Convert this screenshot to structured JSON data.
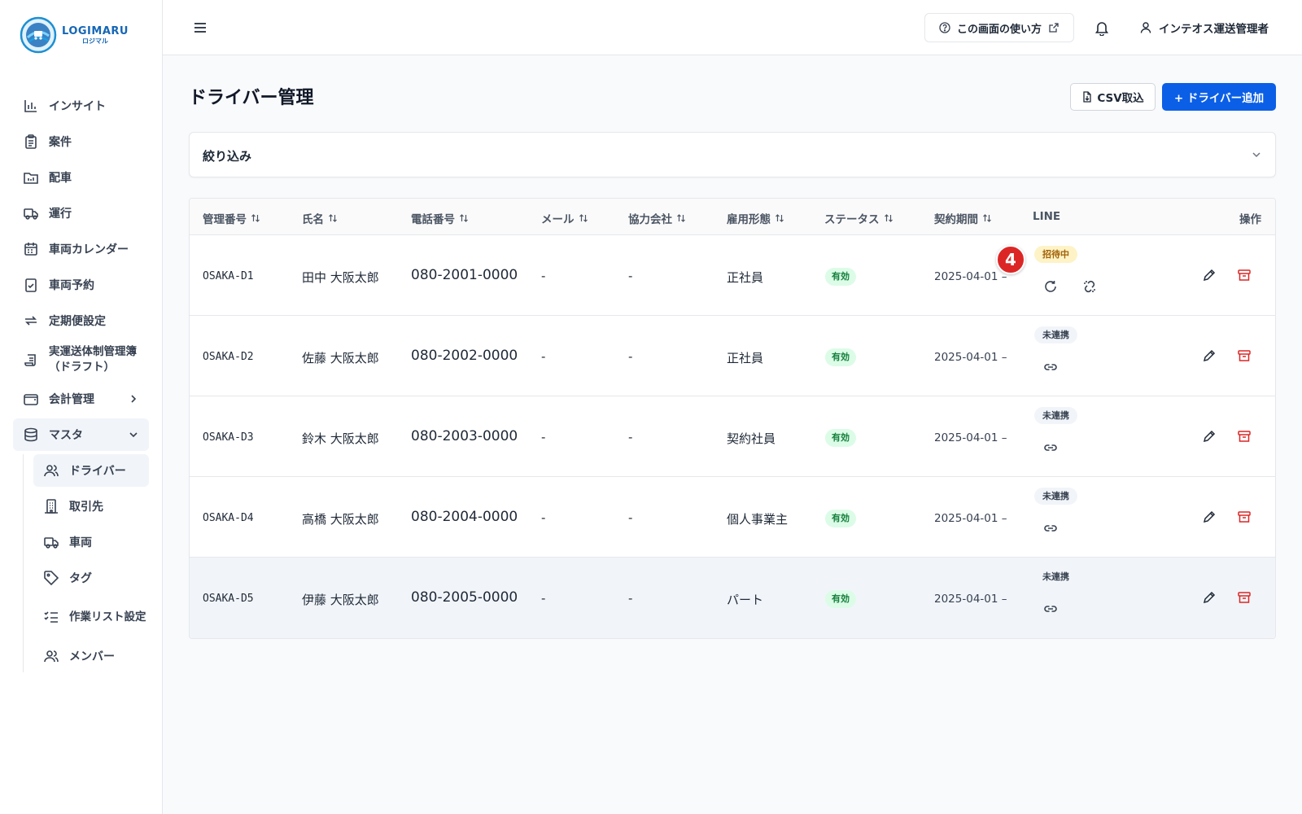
{
  "logo": {
    "en": "LOGIMARU",
    "ja": "ロジマル"
  },
  "sidebar": {
    "items": [
      {
        "label": "インサイト",
        "icon": "bar-chart-icon"
      },
      {
        "label": "案件",
        "icon": "clipboard-icon"
      },
      {
        "label": "配車",
        "icon": "folder-chart-icon"
      },
      {
        "label": "運行",
        "icon": "truck-icon"
      },
      {
        "label": "車両カレンダー",
        "icon": "calendar-icon"
      },
      {
        "label": "車両予約",
        "icon": "calendar-check-icon"
      },
      {
        "label": "定期便設定",
        "icon": "repeat-icon"
      },
      {
        "label": "実運送体制管理簿（ドラフト）",
        "icon": "scroll-icon"
      },
      {
        "label": "会計管理",
        "icon": "wallet-icon"
      },
      {
        "label": "マスタ",
        "icon": "database-icon"
      }
    ],
    "sub_items": [
      {
        "label": "ドライバー",
        "icon": "users-icon"
      },
      {
        "label": "取引先",
        "icon": "building-icon"
      },
      {
        "label": "車両",
        "icon": "truck-icon"
      },
      {
        "label": "タグ",
        "icon": "tag-icon"
      },
      {
        "label": "作業リスト設定",
        "icon": "list-checks-icon"
      },
      {
        "label": "メンバー",
        "icon": "users-icon"
      }
    ]
  },
  "header": {
    "help_label": "この画面の使い方",
    "user_name": "インテオス運送管理者"
  },
  "page": {
    "title": "ドライバー管理",
    "csv_label": "CSV取込",
    "add_label": "+ ドライバー追加"
  },
  "filter": {
    "label": "絞り込み"
  },
  "table": {
    "headers": {
      "id": "管理番号",
      "name": "氏名",
      "phone": "電話番号",
      "mail": "メール",
      "partner": "協力会社",
      "employment": "雇用形態",
      "status": "ステータス",
      "contract": "契約期間",
      "line": "LINE",
      "actions": "操作"
    },
    "rows": [
      {
        "id": "OSAKA-D1",
        "name": "田中 大阪太郎",
        "phone": "080-2001-0000",
        "mail": "-",
        "partner": "-",
        "employment": "正社員",
        "status": "有効",
        "contract": "2025-04-01 –",
        "line": "招待中"
      },
      {
        "id": "OSAKA-D2",
        "name": "佐藤 大阪太郎",
        "phone": "080-2002-0000",
        "mail": "-",
        "partner": "-",
        "employment": "正社員",
        "status": "有効",
        "contract": "2025-04-01 –",
        "line": "未連携"
      },
      {
        "id": "OSAKA-D3",
        "name": "鈴木 大阪太郎",
        "phone": "080-2003-0000",
        "mail": "-",
        "partner": "-",
        "employment": "契約社員",
        "status": "有効",
        "contract": "2025-04-01 –",
        "line": "未連携"
      },
      {
        "id": "OSAKA-D4",
        "name": "高橋 大阪太郎",
        "phone": "080-2004-0000",
        "mail": "-",
        "partner": "-",
        "employment": "個人事業主",
        "status": "有効",
        "contract": "2025-04-01 –",
        "line": "未連携"
      },
      {
        "id": "OSAKA-D5",
        "name": "伊藤 大阪太郎",
        "phone": "080-2005-0000",
        "mail": "-",
        "partner": "-",
        "employment": "パート",
        "status": "有効",
        "contract": "2025-04-01 –",
        "line": "未連携"
      }
    ]
  },
  "marker": {
    "label": "4"
  },
  "colors": {
    "primary": "#0b5fe6",
    "danger": "#dc2626",
    "success_bg": "#dcfce7",
    "warning_bg": "#fef3c7"
  }
}
